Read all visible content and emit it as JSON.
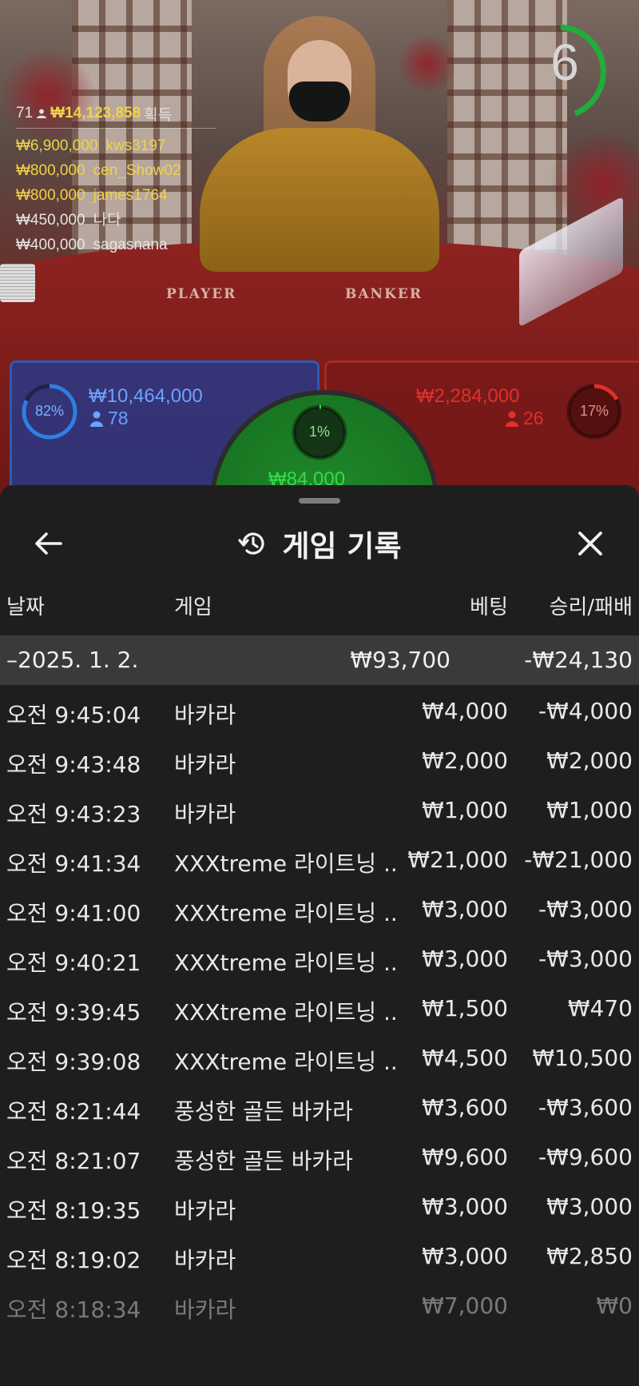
{
  "stream": {
    "timer": "6",
    "player_label": "PLAYER",
    "banker_label": "BANKER",
    "winners": {
      "count": "71",
      "total": "₩14,123,858",
      "suffix": "획득",
      "list": [
        {
          "amount": "₩6,900,000",
          "user": "kws3197",
          "tone": "gold"
        },
        {
          "amount": "₩800,000",
          "user": "cen_Show02",
          "tone": "gold"
        },
        {
          "amount": "₩800,000",
          "user": "james1764",
          "tone": "gold"
        },
        {
          "amount": "₩450,000",
          "user": "나다",
          "tone": "silver"
        },
        {
          "amount": "₩400,000",
          "user": "sagasnana",
          "tone": "silver"
        }
      ]
    },
    "bets": {
      "player": {
        "pct": "82%",
        "pct_value": 0.82,
        "amount": "₩10,464,000",
        "count": "78",
        "color": "#2f7fe0"
      },
      "banker": {
        "pct": "17%",
        "pct_value": 0.17,
        "amount": "₩2,284,000",
        "count": "26",
        "color": "#e0302a"
      },
      "tie": {
        "pct": "1%",
        "pct_value": 0.01,
        "amount": "₩84,000",
        "color": "#39d94a"
      }
    }
  },
  "history": {
    "title": "게임 기록",
    "columns": {
      "date": "날짜",
      "game": "게임",
      "bet": "베팅",
      "result": "승리/패배"
    },
    "day": {
      "label": "–2025. 1. 2.",
      "bet": "₩93,700",
      "result": "-₩24,130"
    },
    "rows": [
      {
        "time": "오전 9:45:04",
        "game": "바카라",
        "bet": "₩4,000",
        "result": "-₩4,000"
      },
      {
        "time": "오전 9:43:48",
        "game": "바카라",
        "bet": "₩2,000",
        "result": "₩2,000"
      },
      {
        "time": "오전 9:43:23",
        "game": "바카라",
        "bet": "₩1,000",
        "result": "₩1,000"
      },
      {
        "time": "오전 9:41:34",
        "game": "XXXtreme 라이트닝 ...",
        "bet": "₩21,000",
        "result": "-₩21,000"
      },
      {
        "time": "오전 9:41:00",
        "game": "XXXtreme 라이트닝 ...",
        "bet": "₩3,000",
        "result": "-₩3,000"
      },
      {
        "time": "오전 9:40:21",
        "game": "XXXtreme 라이트닝 ...",
        "bet": "₩3,000",
        "result": "-₩3,000"
      },
      {
        "time": "오전 9:39:45",
        "game": "XXXtreme 라이트닝 ...",
        "bet": "₩1,500",
        "result": "₩470"
      },
      {
        "time": "오전 9:39:08",
        "game": "XXXtreme 라이트닝 ...",
        "bet": "₩4,500",
        "result": "₩10,500"
      },
      {
        "time": "오전 8:21:44",
        "game": "풍성한 골든 바카라",
        "bet": "₩3,600",
        "result": "-₩3,600"
      },
      {
        "time": "오전 8:21:07",
        "game": "풍성한 골든 바카라",
        "bet": "₩9,600",
        "result": "-₩9,600"
      },
      {
        "time": "오전 8:19:35",
        "game": "바카라",
        "bet": "₩3,000",
        "result": "₩3,000"
      },
      {
        "time": "오전 8:19:02",
        "game": "바카라",
        "bet": "₩3,000",
        "result": "₩2,850"
      },
      {
        "time": "오전 8:18:34",
        "game": "바카라",
        "bet": "₩7,000",
        "result": "₩0"
      }
    ]
  }
}
